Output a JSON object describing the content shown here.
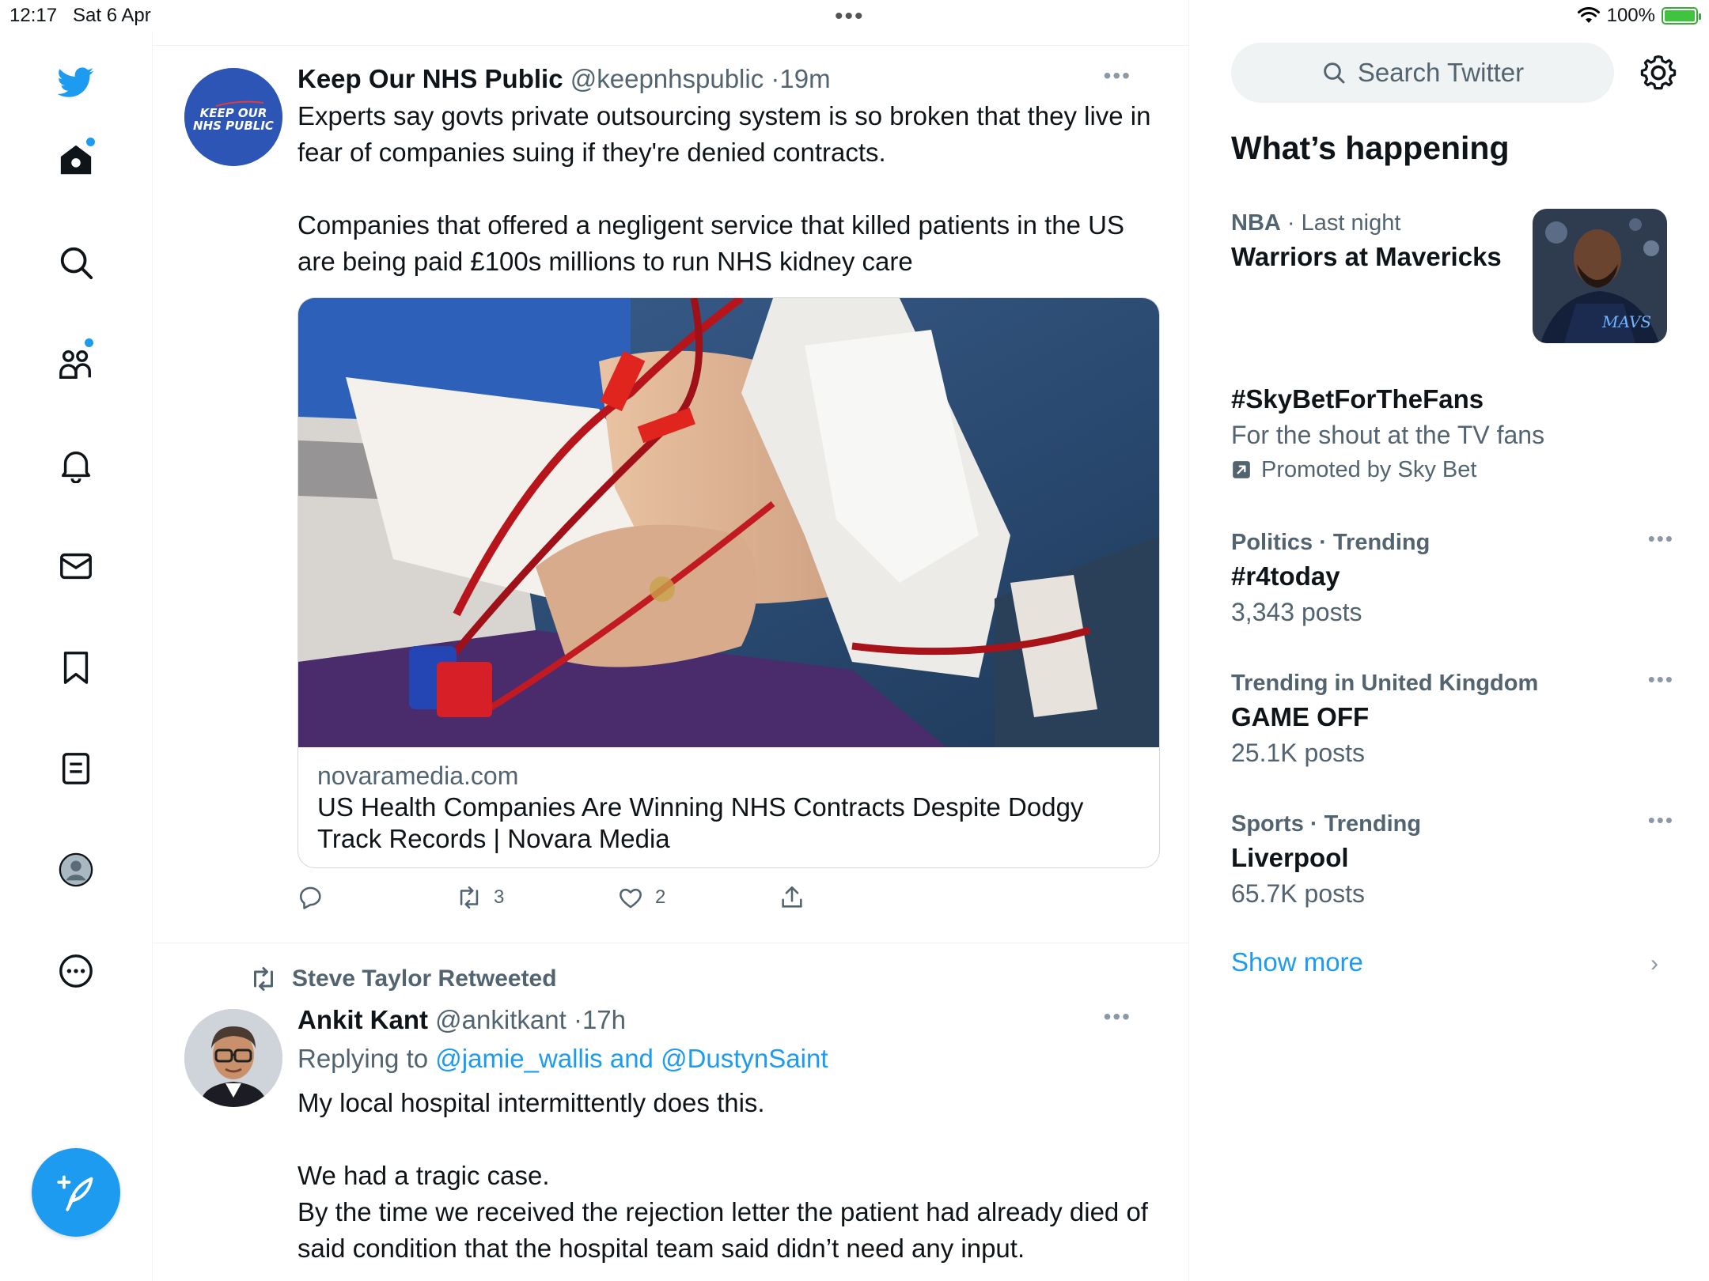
{
  "status_bar": {
    "time": "12:17",
    "date": "Sat 6 Apr",
    "dots": "•••",
    "battery": "100%"
  },
  "nav": {
    "items": [
      "twitter-logo",
      "home",
      "explore",
      "communities",
      "notifications",
      "messages",
      "bookmarks",
      "lists",
      "profile",
      "more"
    ],
    "compose_label": "Compose"
  },
  "tweets": [
    {
      "name": "Keep Our NHS Public",
      "handle": "@keepnhspublic",
      "time": "19m",
      "avatar_text_1": "KEEP OUR",
      "avatar_text_2": "NHS PUBLIC",
      "text_1": "Experts say govts private outsourcing system is so broken that they live in fear of companies suing if they're denied contracts.",
      "text_2": "Companies that offered a negligent service that killed patients in the US are being paid £100s millions to run NHS kidney care",
      "card": {
        "domain": "novaramedia.com",
        "title": "US Health Companies Are Winning NHS Contracts Despite Dodgy Track Records | Novara Media"
      },
      "retweets": "3",
      "likes": "2"
    },
    {
      "retweeted_by": "Steve Taylor Retweeted",
      "name": "Ankit Kant",
      "handle": "@ankitkant",
      "time": "17h",
      "replying_prefix": "Replying to",
      "replying_to": "@jamie_wallis and @DustynSaint",
      "text_1": "My local hospital intermittently does this.",
      "text_2": "We had a tragic case.",
      "text_3": "By the time we received the rejection letter the patient had already died of said condition that the hospital team said didn’t need any input."
    }
  ],
  "sidebar": {
    "search_placeholder": "Search Twitter",
    "whats_happening": "What’s happening",
    "trends": [
      {
        "category": "NBA",
        "meta": "· Last night",
        "title": "Warriors at Mavericks"
      },
      {
        "title": "#SkyBetForTheFans",
        "subtitle": "For the shout at the TV fans",
        "promoted": "Promoted by Sky Bet"
      },
      {
        "meta": "Politics · Trending",
        "title": "#r4today",
        "posts": "3,343 posts"
      },
      {
        "meta": "Trending in United Kingdom",
        "title": "GAME OFF",
        "posts": "25.1K posts"
      },
      {
        "meta": "Sports · Trending",
        "title": "Liverpool",
        "posts": "65.7K posts"
      }
    ],
    "show_more": "Show more"
  },
  "colors": {
    "accent": "#1d9bf0",
    "text": "#0f1419",
    "secondary": "#536471",
    "border": "#eff3f4"
  }
}
